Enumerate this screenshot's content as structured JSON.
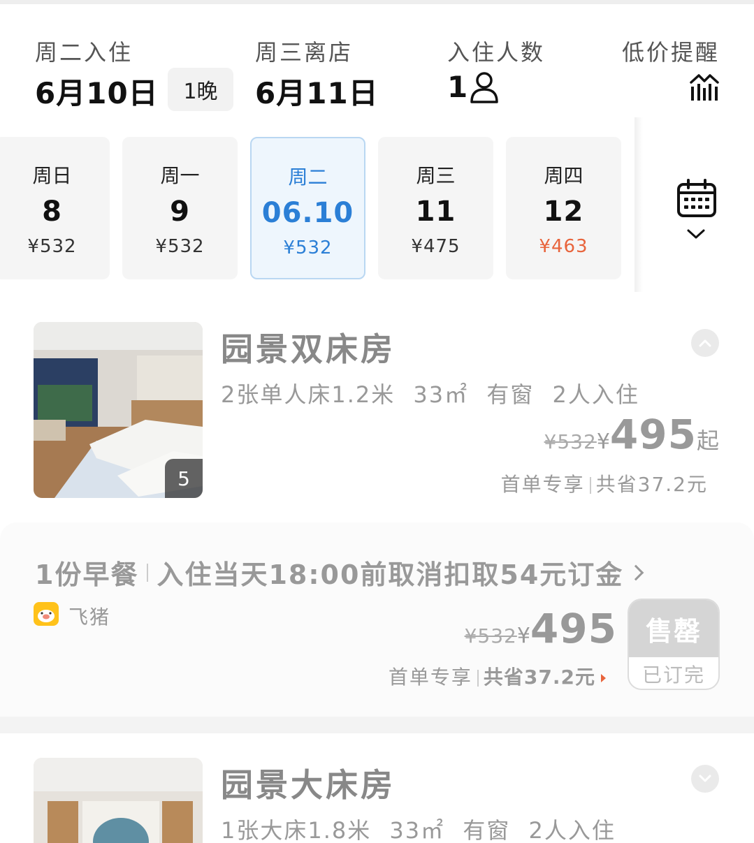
{
  "header": {
    "checkin_label": "周二入住",
    "checkin_date": "6月10日",
    "nights": "1晚",
    "checkout_label": "周三离店",
    "checkout_date": "6月11日",
    "guests_label": "入住人数",
    "guests_count": "1",
    "alert_label": "低价提醒",
    "guest_icon": "person-icon",
    "alert_icon": "price-trend-icon"
  },
  "dates": [
    {
      "weekday": "周日",
      "day": "8",
      "price": "¥532",
      "selected": false
    },
    {
      "weekday": "周一",
      "day": "9",
      "price": "¥532",
      "selected": false
    },
    {
      "weekday": "周二",
      "day": "06.10",
      "price": "¥532",
      "selected": true
    },
    {
      "weekday": "周三",
      "day": "11",
      "price": "¥475",
      "selected": false
    },
    {
      "weekday": "周四",
      "day": "12",
      "price": "¥463",
      "selected": false,
      "lowest": true
    }
  ],
  "colors": {
    "accent_blue": "#2b7fd6",
    "low_price_orange": "#e8643c",
    "brand_yellow": "#ffc21a"
  },
  "rooms": [
    {
      "name": "园景双床房",
      "specs": "2张单人床1.2米 33㎡ 有窗 2人入住",
      "photo_count": "5",
      "original_price": "¥532",
      "currency": "¥",
      "price": "495",
      "price_suffix": "起",
      "promo_label": "首单专享",
      "savings": "共省37.2元",
      "expanded": true,
      "plan": {
        "meal": "1份早餐",
        "cancel_policy": "入住当天18:00前取消扣取54元订金",
        "channel": "飞猪",
        "original_price": "¥532",
        "currency": "¥",
        "price": "495",
        "promo_label": "首单专享",
        "savings": "共省37.2元",
        "button_top": "售罄",
        "button_bottom": "已订完"
      }
    },
    {
      "name": "园景大床房",
      "specs": "1张大床1.8米 33㎡ 有窗 2人入住",
      "expanded": false
    }
  ]
}
